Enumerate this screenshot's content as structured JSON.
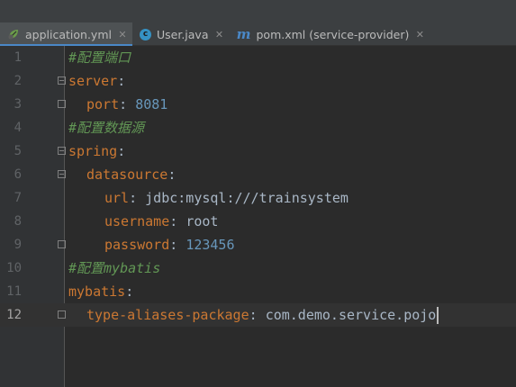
{
  "tabs": [
    {
      "label": "application.yml",
      "icon": "yaml-leaf-icon",
      "active": true
    },
    {
      "label": "User.java",
      "icon": "java-class-icon",
      "active": false
    },
    {
      "label": "pom.xml (service-provider)",
      "icon": "maven-icon",
      "active": false
    }
  ],
  "tab_icon_glyphs": {
    "c": "c",
    "m": "m"
  },
  "close_glyph": "✕",
  "colors": {
    "background": "#2b2b2b",
    "comment": "#629755",
    "key": "#cc7832",
    "number": "#6897bb",
    "text": "#a9b7c6",
    "active_tab_underline": "#4a88c7"
  },
  "editor": {
    "current_line": 12,
    "lines": [
      {
        "n": "1",
        "comment": "#配置端口"
      },
      {
        "n": "2",
        "key": "server",
        "colon": ":"
      },
      {
        "n": "3",
        "key": "port",
        "colon": ": ",
        "num": "8081"
      },
      {
        "n": "4",
        "comment": "#配置数据源"
      },
      {
        "n": "5",
        "key": "spring",
        "colon": ":"
      },
      {
        "n": "6",
        "key": "datasource",
        "colon": ":"
      },
      {
        "n": "7",
        "key": "url",
        "colon": ": ",
        "value": "jdbc:mysql:///trainsystem"
      },
      {
        "n": "8",
        "key": "username",
        "colon": ": ",
        "value": "root"
      },
      {
        "n": "9",
        "key": "password",
        "colon": ": ",
        "num": "123456"
      },
      {
        "n": "10",
        "comment": "#配置mybatis"
      },
      {
        "n": "11",
        "key": "mybatis",
        "colon": ":"
      },
      {
        "n": "12",
        "key": "type-aliases-package",
        "colon": ": ",
        "value": "com.demo.service.pojo"
      }
    ]
  }
}
